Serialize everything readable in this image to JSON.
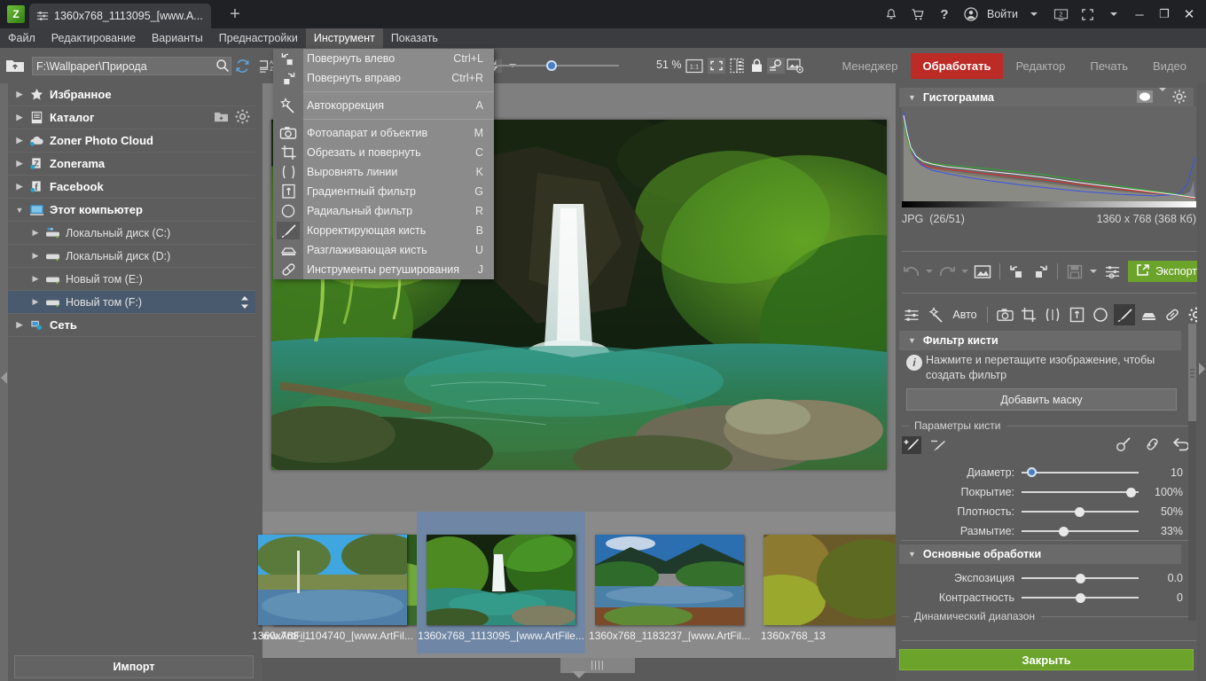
{
  "titlebar": {
    "tab_label": "1360x768_1113095_[www.A...",
    "new_tab": "+",
    "signin_label": "Войти",
    "monitor_badge": "2",
    "icons": [
      "bell-icon",
      "cart-icon",
      "help-icon",
      "user-icon",
      "monitor-icon",
      "fullscreen-icon"
    ],
    "window": {
      "minimize": "─",
      "restore": "❐",
      "close": "✕"
    }
  },
  "menubar": {
    "items": [
      {
        "label": "Файл",
        "active": false
      },
      {
        "label": "Редактирование",
        "active": false
      },
      {
        "label": "Варианты",
        "active": false
      },
      {
        "label": "Преднастройки",
        "active": false
      },
      {
        "label": "Инструмент",
        "active": true
      },
      {
        "label": "Показать",
        "active": false
      }
    ]
  },
  "dropdown": {
    "groups": [
      [
        {
          "label": "Повернуть влево",
          "key": "Ctrl+L",
          "icon": "rotate-left-icon",
          "active": false
        },
        {
          "label": "Повернуть вправо",
          "key": "Ctrl+R",
          "icon": "rotate-right-icon",
          "active": false
        }
      ],
      [
        {
          "label": "Автокоррекция",
          "key": "A",
          "icon": "magic-wand-icon",
          "active": false
        }
      ],
      [
        {
          "label": "Фотоапарат и объектив",
          "key": "M",
          "icon": "camera-icon",
          "active": false
        },
        {
          "label": "Обрезать и повернуть",
          "key": "C",
          "icon": "crop-icon",
          "active": false
        },
        {
          "label": "Выровнять линии",
          "key": "K",
          "icon": "perspective-icon",
          "active": false
        },
        {
          "label": "Градиентный фильтр",
          "key": "G",
          "icon": "gradient-filter-icon",
          "active": false
        },
        {
          "label": "Радиальный фильтр",
          "key": "R",
          "icon": "radial-filter-icon",
          "active": false
        },
        {
          "label": "Корректирующая кисть",
          "key": "B",
          "icon": "brush-icon",
          "active": true
        },
        {
          "label": "Разглаживающая кисть",
          "key": "U",
          "icon": "smoothing-brush-icon",
          "active": false
        },
        {
          "label": "Инструменты ретуширования",
          "key": "J",
          "icon": "retouch-icon",
          "active": false
        }
      ]
    ]
  },
  "toolbar": {
    "path_value": "F:\\Wallpaper\\Природа",
    "zoom_percent": "51 %",
    "icons": [
      "folder-up-icon",
      "search-icon",
      "refresh-icon",
      "sort-az-icon",
      "flash-icon",
      "one-to-one-icon",
      "fit-screen-icon",
      "compare-icon",
      "lock-icon",
      "quick-filter-icon",
      "image-settings-icon"
    ],
    "modes": [
      {
        "label": "Менеджер",
        "selected": false
      },
      {
        "label": "Обработать",
        "selected": true
      },
      {
        "label": "Редактор",
        "selected": false
      },
      {
        "label": "Печать",
        "selected": false
      },
      {
        "label": "Видео",
        "selected": false
      }
    ]
  },
  "sidebar": {
    "items": [
      {
        "label": "Избранное",
        "icon": "star-icon",
        "level": 0,
        "expanded": false,
        "selected": false
      },
      {
        "label": "Каталог",
        "icon": "catalog-icon",
        "level": 0,
        "expanded": false,
        "selected": false,
        "actions": [
          "add-folder-icon",
          "gear-icon"
        ]
      },
      {
        "label": "Zoner Photo Cloud",
        "icon": "cloud-icon",
        "level": 0,
        "expanded": false,
        "selected": false
      },
      {
        "label": "Zonerama",
        "icon": "zonerama-icon",
        "level": 0,
        "expanded": false,
        "selected": false
      },
      {
        "label": "Facebook",
        "icon": "facebook-icon",
        "level": 0,
        "expanded": false,
        "selected": false
      },
      {
        "label": "Этот компьютер",
        "icon": "computer-icon",
        "level": 0,
        "expanded": true,
        "selected": false
      },
      {
        "label": "Локальный диск (C:)",
        "icon": "disk-system-icon",
        "level": 1,
        "expanded": false,
        "selected": false
      },
      {
        "label": "Локальный диск (D:)",
        "icon": "disk-icon",
        "level": 1,
        "expanded": false,
        "selected": false
      },
      {
        "label": "Новый том (E:)",
        "icon": "disk-icon",
        "level": 1,
        "expanded": false,
        "selected": false
      },
      {
        "label": "Новый том (F:)",
        "icon": "disk-icon",
        "level": 1,
        "expanded": false,
        "selected": true
      },
      {
        "label": "Сеть",
        "icon": "network-icon",
        "level": 0,
        "expanded": false,
        "selected": false
      }
    ],
    "import_label": "Импорт"
  },
  "filmstrip": {
    "thumbs": [
      {
        "caption": "ww.ArtFil...",
        "selected": false
      },
      {
        "caption": "1360x768_1104740_[www.ArtFil...",
        "selected": false
      },
      {
        "caption": "1360x768_1113095_[www.ArtFile...",
        "selected": true
      },
      {
        "caption": "1360x768_1183237_[www.ArtFil...",
        "selected": false
      },
      {
        "caption": "1360x768_13",
        "selected": false
      }
    ],
    "handle": "||||"
  },
  "right_panel": {
    "histogram": {
      "title": "Гистограмма",
      "format": "JPG",
      "counter": "(26/51)",
      "dimensions": "1360 x 768 (368 Кб)",
      "icons": [
        "histogram-mode-icon",
        "chevron-down-icon",
        "gear-icon"
      ]
    },
    "edit_toolbar": {
      "icons": [
        "undo-icon",
        "undo-dropdown-icon",
        "redo-icon",
        "redo-dropdown-icon",
        "compare-image-icon",
        "rotate-left-icon",
        "rotate-right-icon",
        "save-icon",
        "save-dropdown-icon",
        "settings-sliders-icon"
      ],
      "export_label": "Экспорт"
    },
    "tools_row": {
      "auto_label": "Авто",
      "icons": [
        "sliders-icon",
        "magic-wand-icon",
        "camera-icon",
        "crop-icon",
        "perspective-icon",
        "gradient-filter-icon",
        "radial-filter-icon",
        "brush-icon",
        "smoothing-brush-icon",
        "retouch-icon",
        "gear-icon"
      ],
      "active": "brush-icon"
    },
    "brush_filter": {
      "title": "Фильтр кисти",
      "hint": "Нажмите и перетащите изображение, чтобы создать фильтр",
      "add_mask_label": "Добавить маску",
      "params_group": "Параметры кисти",
      "mode_icons": [
        "brush-add-icon",
        "brush-erase-icon"
      ],
      "right_icons": [
        "pick-color-icon",
        "link-icon",
        "reset-icon"
      ],
      "sliders": [
        {
          "label": "Диаметр:",
          "value": "10",
          "pos": 8,
          "accent": true
        },
        {
          "label": "Покрытие:",
          "value": "100%",
          "pos": 100,
          "accent": false
        },
        {
          "label": "Плотность:",
          "value": "50%",
          "pos": 56,
          "accent": false
        },
        {
          "label": "Размытие:",
          "value": "33%",
          "pos": 40,
          "accent": false
        }
      ]
    },
    "basic_edits": {
      "title": "Основные обработки",
      "sliders": [
        {
          "label": "Экспозиция",
          "value": "0.0",
          "pos": 50
        },
        {
          "label": "Контрастность",
          "value": "0",
          "pos": 50
        }
      ],
      "dynamic_range_group": "Динамический диапазон"
    },
    "close_label": "Закрыть"
  },
  "colors": {
    "accent_red": "#bd2b26",
    "accent_green": "#6ba32b",
    "selection_blue": "#4a5a6e",
    "panel_bg": "#5d5d5d",
    "titlebar_bg": "#1f2124"
  }
}
